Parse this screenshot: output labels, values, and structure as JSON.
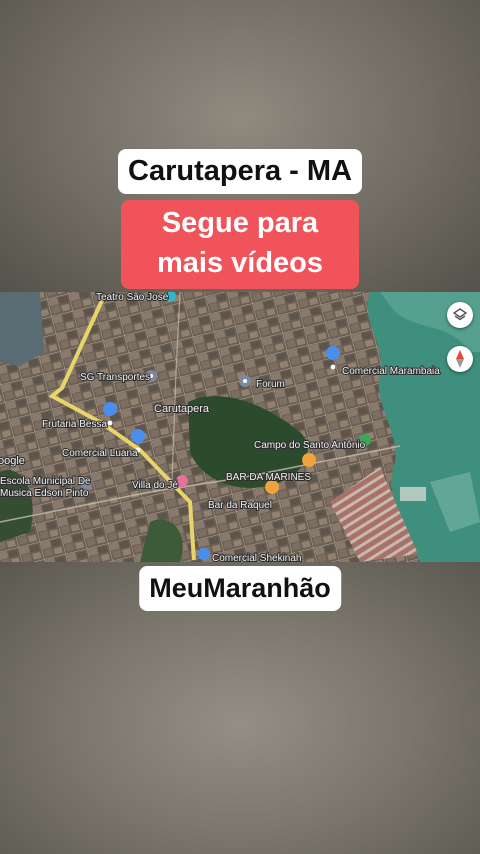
{
  "captions": {
    "title": "Carutapera - MA",
    "cta": "Segue para mais vídeos",
    "brand": "MeuMaranhão"
  },
  "map": {
    "city_label": "Carutapera",
    "watermark": "oogle",
    "places": [
      {
        "name": "Teatro São José",
        "icon": "theater-pin-icon"
      },
      {
        "name": "SG Transportes",
        "icon": "place-pin-icon"
      },
      {
        "name": "Forum",
        "icon": "place-pin-icon"
      },
      {
        "name": "Comercial Marambaia",
        "icon": "shop-pin-icon"
      },
      {
        "name": "Frutaria Bessa",
        "icon": "shop-pin-icon"
      },
      {
        "name": "Comercial Luana",
        "icon": "shop-pin-icon"
      },
      {
        "name": "Villa do Jé",
        "icon": "hotel-pin-icon"
      },
      {
        "name": "Escola Municipal De",
        "icon": "school-pin-icon"
      },
      {
        "name": "Musica Edson Pinto",
        "icon": "school-pin-icon"
      },
      {
        "name": "Campo do Santo Antônio",
        "icon": "park-pin-icon"
      },
      {
        "name": "BAR DA MARINES",
        "icon": "bar-pin-icon"
      },
      {
        "name": "Bar da Raquel",
        "icon": "bar-pin-icon"
      },
      {
        "name": "Comercial Shekinah",
        "icon": "shop-pin-icon"
      }
    ],
    "controls": {
      "layers_icon": "layers-icon",
      "compass_icon": "compass-icon"
    },
    "colors": {
      "road": "#e8d56a",
      "water": "#3f8f7e",
      "vegetation": "#2c4a2c",
      "pin_blue": "#4a8ff0",
      "pin_orange": "#f2a23a",
      "pin_green": "#3aa757"
    }
  }
}
